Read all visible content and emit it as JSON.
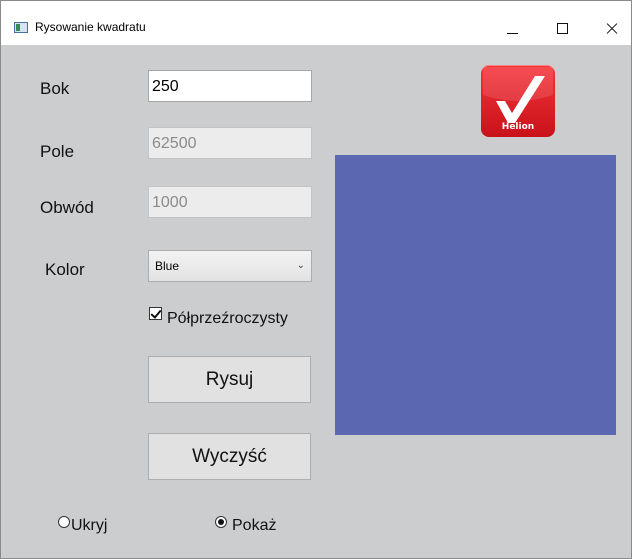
{
  "window": {
    "title": "Rysowanie kwadratu"
  },
  "form": {
    "side_label": "Bok",
    "side_value": "250",
    "area_label": "Pole",
    "area_value": "62500",
    "perimeter_label": "Obwód",
    "perimeter_value": "1000",
    "color_label": "Kolor",
    "color_selected": "Blue",
    "semi_transparent_label": "Półprzeźroczysty",
    "semi_transparent_checked": true,
    "draw_button": "Rysuj",
    "clear_button": "Wyczyść"
  },
  "visibility": {
    "hide_label": "Ukryj",
    "show_label": "Pokaż",
    "selected": "show"
  },
  "logo": {
    "text": "Helion",
    "color": "#e3262c"
  },
  "square": {
    "color": "#5b68b1"
  },
  "icons": {
    "app": "app-window-icon",
    "minimize": "minimize-icon",
    "maximize": "maximize-icon",
    "close": "close-icon",
    "dropdown": "chevron-down-icon"
  }
}
